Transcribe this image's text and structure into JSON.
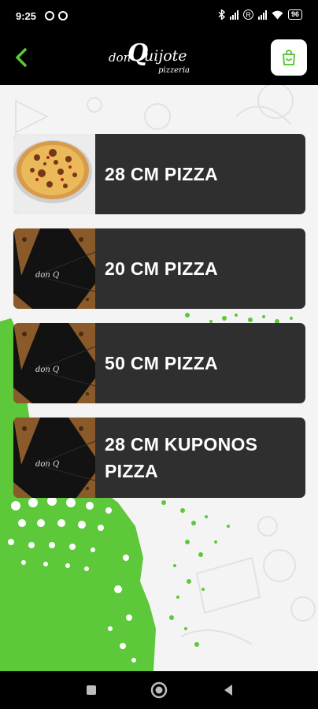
{
  "status_bar": {
    "time": "9:25",
    "battery": "96",
    "icons": [
      "alarm-icon",
      "camera-icon",
      "bluetooth-icon",
      "signal-icon",
      "signal-r-icon",
      "signal-icon",
      "wifi-icon",
      "battery-icon"
    ],
    "roaming_marker": "R"
  },
  "app_bar": {
    "back_icon": "chevron-left-icon",
    "logo_don": "don",
    "logo_q": "Q",
    "logo_uijote": "uijote",
    "logo_pizzeria": "pizzeria",
    "cart_icon": "shopping-bag-icon",
    "accent_color": "#5cc83a"
  },
  "menu": {
    "items": [
      {
        "label": "28 CM PIZZA",
        "image": "pizza-photo"
      },
      {
        "label": "20 CM PIZZA",
        "image": "logo-pizza-photo"
      },
      {
        "label": "50 CM PIZZA",
        "image": "logo-pizza-photo"
      },
      {
        "label": "28 CM KUPONOS PIZZA",
        "image": "logo-pizza-photo"
      }
    ]
  },
  "colors": {
    "card_background": "#2f2f2f",
    "accent_green": "#5cc83a",
    "page_background": "#f4f4f4"
  },
  "nav_bar": {
    "icons": [
      "square-recents-icon",
      "circle-home-icon",
      "triangle-back-icon"
    ]
  }
}
